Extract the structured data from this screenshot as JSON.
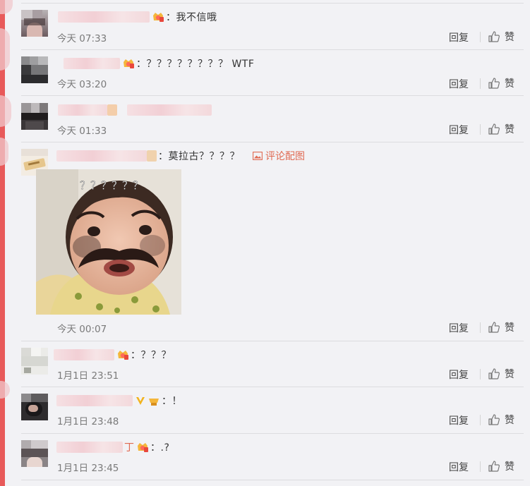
{
  "colors": {
    "accent": "#e85a5a",
    "link": "#e06a52",
    "background": "#f2f2f5"
  },
  "actions": {
    "reply": "回复",
    "like": "赞"
  },
  "comments": [
    {
      "text": "：我不信哦",
      "time": "今天 07:33"
    },
    {
      "text": "：？？？？？？？？ WTF",
      "time": "今天 03:20"
    },
    {
      "text": "",
      "time": "今天 01:33"
    },
    {
      "text": "：莫拉古？？？？",
      "time": "今天 00:07",
      "pic_link": "评论配图",
      "image_caption": "？？？？？？"
    },
    {
      "text": "：？？？",
      "time": "1月1日 23:51"
    },
    {
      "text": "：！",
      "time": "1月1日 23:48"
    },
    {
      "text": "：.?",
      "time": "1月1日 23:45"
    }
  ],
  "icons": [
    "crown-badge-icon",
    "thumbs-up-icon",
    "image-icon",
    "v-badge-icon"
  ]
}
